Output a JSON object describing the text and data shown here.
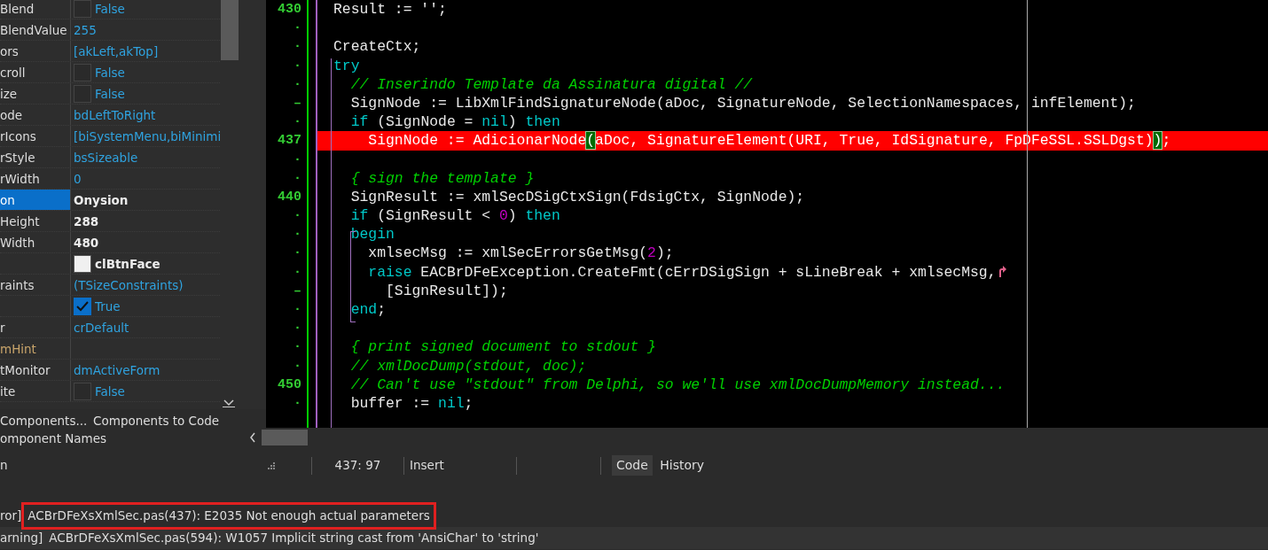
{
  "object_inspector": {
    "rows": [
      {
        "name": "Blend",
        "kind": "checkbox",
        "value": "False",
        "checked": false
      },
      {
        "name": "BlendValue",
        "kind": "text",
        "value": "255"
      },
      {
        "name": "ors",
        "kind": "text",
        "value": "[akLeft,akTop]"
      },
      {
        "name": "croll",
        "kind": "checkbox",
        "value": "False",
        "checked": false
      },
      {
        "name": "ize",
        "kind": "checkbox",
        "value": "False",
        "checked": false
      },
      {
        "name": "ode",
        "kind": "text",
        "value": "bdLeftToRight"
      },
      {
        "name": "rIcons",
        "kind": "text",
        "value": "[biSystemMenu,biMinimi"
      },
      {
        "name": "rStyle",
        "kind": "text",
        "value": "bsSizeable"
      },
      {
        "name": "rWidth",
        "kind": "text",
        "value": "0"
      },
      {
        "name": "on",
        "kind": "text",
        "value": "Onysion",
        "selected": true,
        "modified": true
      },
      {
        "name": "Height",
        "kind": "text",
        "value": "288",
        "modified": true
      },
      {
        "name": "Width",
        "kind": "text",
        "value": "480",
        "modified": true
      },
      {
        "name": "",
        "kind": "color",
        "value": "clBtnFace",
        "color": "#f0f0f0",
        "modified": true
      },
      {
        "name": "raints",
        "kind": "text",
        "value": "(TSizeConstraints)"
      },
      {
        "name": "",
        "kind": "checkbox",
        "value": "True",
        "checked": true
      },
      {
        "name": "r",
        "kind": "text",
        "value": "crDefault"
      },
      {
        "name": "mHint",
        "kind": "text",
        "value": "",
        "reference": true
      },
      {
        "name": "tMonitor",
        "kind": "text",
        "value": "dmActiveForm"
      },
      {
        "name": "ite",
        "kind": "checkbox",
        "value": "False",
        "checked": false
      }
    ],
    "links": [
      [
        "Components...",
        "Components to Code"
      ],
      [
        "omponent Names"
      ]
    ]
  },
  "editor": {
    "lines": [
      {
        "number": "430",
        "segments": [
          {
            "kind": "plain",
            "text": "Result := '';"
          }
        ]
      },
      {
        "number": "·"
      },
      {
        "number": "·",
        "segments": [
          {
            "kind": "plain",
            "text": "CreateCtx;"
          }
        ]
      },
      {
        "number": "·",
        "segments": [
          {
            "kind": "keyword",
            "text": "try"
          }
        ]
      },
      {
        "number": "·",
        "segments": [
          {
            "kind": "comment",
            "text": "  // Inserindo Template da Assinatura digital //"
          }
        ]
      },
      {
        "number": "–",
        "segments": [
          {
            "kind": "plain",
            "text": "  SignNode := LibXmlFindSignatureNode(aDoc, SignatureNode, SelectionNamespaces, infElement);"
          }
        ]
      },
      {
        "number": "·",
        "segments": [
          {
            "kind": "keyword",
            "text": "  if"
          },
          {
            "kind": "plain",
            "text": " (SignNode = "
          },
          {
            "kind": "keyword",
            "text": "nil"
          },
          {
            "kind": "plain",
            "text": ") "
          },
          {
            "kind": "keyword",
            "text": "then"
          }
        ]
      },
      {
        "number": "437",
        "error": true,
        "segments": [
          {
            "kind": "plain",
            "text": "    SignNode := AdicionarNode"
          },
          {
            "kind": "bracket",
            "text": "("
          },
          {
            "kind": "plain",
            "text": "aDoc, SignatureElement(URI, True, IdSignature, FpDFeSSL.SSLDgst)"
          },
          {
            "kind": "bracket",
            "text": ")"
          },
          {
            "kind": "plain",
            "text": ";"
          }
        ]
      },
      {
        "number": "·"
      },
      {
        "number": "·",
        "segments": [
          {
            "kind": "comment",
            "text": "  { sign the template }"
          }
        ]
      },
      {
        "number": "440",
        "segments": [
          {
            "kind": "plain",
            "text": "  SignResult := xmlSecDSigCtxSign(FdsigCtx, SignNode);"
          }
        ]
      },
      {
        "number": "·",
        "segments": [
          {
            "kind": "keyword",
            "text": "  if"
          },
          {
            "kind": "plain",
            "text": " (SignResult < "
          },
          {
            "kind": "number",
            "text": "0"
          },
          {
            "kind": "plain",
            "text": ") "
          },
          {
            "kind": "keyword",
            "text": "then"
          }
        ]
      },
      {
        "number": "·",
        "segments": [
          {
            "kind": "keyword",
            "text": "  begin"
          }
        ]
      },
      {
        "number": "·",
        "segments": [
          {
            "kind": "plain",
            "text": "    xmlsecMsg := xmlSecErrorsGetMsg("
          },
          {
            "kind": "number",
            "text": "2"
          },
          {
            "kind": "plain",
            "text": ");"
          }
        ]
      },
      {
        "number": "·",
        "wrapped": true,
        "segments": [
          {
            "kind": "keyword",
            "text": "    raise"
          },
          {
            "kind": "plain",
            "text": " EACBrDFeException.CreateFmt(cErrDSigSign + sLineBreak + xmlsecMsg,"
          }
        ]
      },
      {
        "number": "–",
        "segments": [
          {
            "kind": "plain",
            "text": "      [SignResult]);"
          }
        ]
      },
      {
        "number": "·",
        "segments": [
          {
            "kind": "keyword",
            "text": "  end"
          },
          {
            "kind": "plain",
            "text": ";"
          }
        ]
      },
      {
        "number": "·"
      },
      {
        "number": "·",
        "segments": [
          {
            "kind": "comment",
            "text": "  { print signed document to stdout }"
          }
        ]
      },
      {
        "number": "·",
        "segments": [
          {
            "kind": "comment",
            "text": "  // xmlDocDump(stdout, doc);"
          }
        ]
      },
      {
        "number": "450",
        "segments": [
          {
            "kind": "comment",
            "text": "  // Can't use \"stdout\" from Delphi, so we'll use xmlDocDumpMemory instead..."
          }
        ]
      },
      {
        "number": "·",
        "segments": [
          {
            "kind": "plain",
            "text": "  buffer := "
          },
          {
            "kind": "keyword",
            "text": "nil"
          },
          {
            "kind": "plain",
            "text": ";"
          }
        ]
      }
    ]
  },
  "status_bar": {
    "label": "n",
    "position": "437: 97",
    "mode": "Insert",
    "tabs": [
      {
        "label": "Code",
        "selected": true
      },
      {
        "label": "History",
        "selected": false
      }
    ]
  },
  "messages": [
    {
      "prefix": "ror]",
      "text": "ACBrDFeXsXmlSec.pas(437): E2035 Not enough actual parameters",
      "annotated": true
    },
    {
      "prefix": "arning]",
      "text": "ACBrDFeXsXmlSec.pas(594): W1057 Implicit string cast from 'AnsiChar' to 'string'",
      "annotated": false
    }
  ]
}
